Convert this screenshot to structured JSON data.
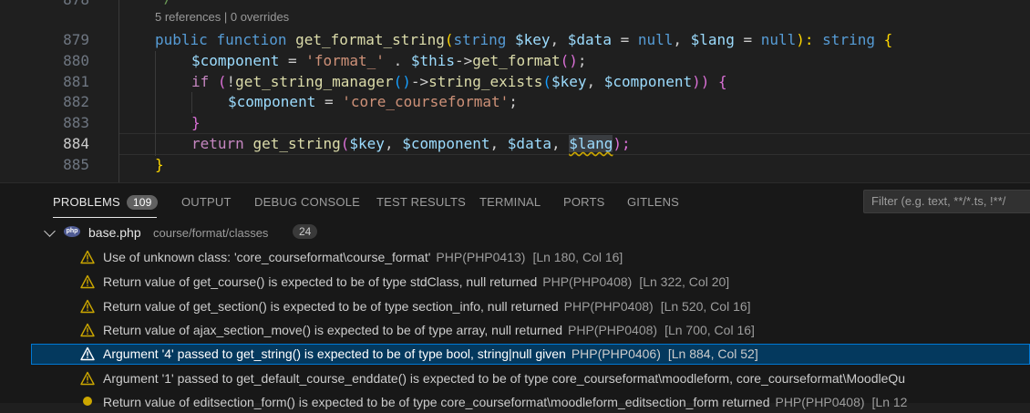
{
  "editor": {
    "top_partial_line_number": "878",
    "codelens": "5 references | 0 overrides",
    "line_numbers": [
      "879",
      "880",
      "881",
      "882",
      "883",
      "884",
      "885"
    ],
    "active_line": "884",
    "code": {
      "l879": [
        "public",
        "function",
        "get_format_string",
        "(",
        "string",
        "$key",
        ", ",
        "$data",
        " = ",
        "null",
        ", ",
        "$lang",
        " = ",
        "null",
        "): ",
        "string",
        " {"
      ],
      "l880": [
        "$component",
        " = ",
        "'format_'",
        " . ",
        "$this",
        "->",
        "get_format",
        "()",
        ";"
      ],
      "l881": [
        "if",
        " (",
        "!",
        "get_string_manager",
        "()",
        "->",
        "string_exists",
        "(",
        "$key",
        ", ",
        "$component",
        "))",
        " {"
      ],
      "l882": [
        "$component",
        " = ",
        "'core_courseformat'",
        ";"
      ],
      "l883": [
        "}"
      ],
      "l884": [
        "return",
        "get_string",
        "(",
        "$key",
        ", ",
        "$component",
        ", ",
        "$data",
        ", ",
        "$lang",
        ");"
      ],
      "l885": [
        "}"
      ]
    }
  },
  "panel": {
    "tabs": [
      {
        "label": "PROBLEMS",
        "badge": "109"
      },
      {
        "label": "OUTPUT"
      },
      {
        "label": "DEBUG CONSOLE"
      },
      {
        "label": "TEST RESULTS"
      },
      {
        "label": "TERMINAL"
      },
      {
        "label": "PORTS"
      },
      {
        "label": "GITLENS"
      }
    ],
    "filter_placeholder": "Filter (e.g. text, **/*.ts, !**/"
  },
  "problems": {
    "file": {
      "icon": "php-file-icon",
      "icon_text": "php",
      "name": "base.php",
      "path": "course/format/classes",
      "count": "24"
    },
    "items": [
      {
        "message": "Use of unknown class: 'core_courseformat\\course_format'",
        "source": "PHP(PHP0413)",
        "location": "[Ln 180, Col 16]"
      },
      {
        "message": "Return value of get_course() is expected to be of type stdClass, null returned",
        "source": "PHP(PHP0408)",
        "location": "[Ln 322, Col 20]"
      },
      {
        "message": "Return value of get_section() is expected to be of type section_info, null returned",
        "source": "PHP(PHP0408)",
        "location": "[Ln 520, Col 16]"
      },
      {
        "message": "Return value of ajax_section_move() is expected to be of type array, null returned",
        "source": "PHP(PHP0408)",
        "location": "[Ln 700, Col 16]"
      },
      {
        "message": "Argument '4' passed to get_string() is expected to be of type bool, string|null given",
        "source": "PHP(PHP0406)",
        "location": "[Ln 884, Col 52]"
      },
      {
        "message": "Argument '1' passed to get_default_course_enddate() is expected to be of type core_courseformat\\moodleform, core_courseformat\\MoodleQu",
        "source": "",
        "location": ""
      },
      {
        "message": "Return value of editsection_form() is expected to be of type core_courseformat\\moodleform_editsection_form returned",
        "source": "PHP(PHP0408)",
        "location": "[Ln 12"
      }
    ],
    "selected_index": 4
  },
  "colors": {
    "warning": "#cca700",
    "selection": "#04395e",
    "focus_border": "#0078d4"
  }
}
